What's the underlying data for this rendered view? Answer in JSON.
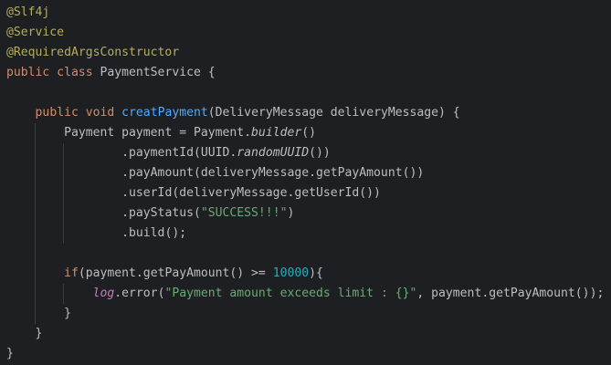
{
  "editor": {
    "colors": {
      "background": "#1e1f22",
      "default_text": "#bcbec4",
      "annotation": "#b3ae60",
      "keyword": "#cf8e6d",
      "method_declaration": "#56a8f5",
      "string": "#6aab73",
      "number": "#2aacb8",
      "static_field": "#c77dbb"
    },
    "lines": {
      "l1": {
        "a": "@Slf4j"
      },
      "l2": {
        "a": "@Service"
      },
      "l3": {
        "a": "@RequiredArgsConstructor"
      },
      "l4": {
        "k": "public class",
        "t": " PaymentService {"
      },
      "l6": {
        "ind": "    ",
        "k": "public void",
        "f": "creatPayment",
        "t": "(DeliveryMessage deliveryMessage) {"
      },
      "l7": {
        "ind": "        ",
        "t1": "Payment payment = Payment.",
        "i": "builder",
        "t2": "()"
      },
      "l8": {
        "ind": "                ",
        "t1": ".paymentId(UUID.",
        "i": "randomUUID",
        "t2": "())"
      },
      "l9": {
        "ind": "                ",
        "t": ".payAmount(deliveryMessage.getPayAmount())"
      },
      "l10": {
        "ind": "                ",
        "t": ".userId(deliveryMessage.getUserId())"
      },
      "l11": {
        "ind": "                ",
        "t1": ".payStatus(",
        "s": "\"SUCCESS!!!\"",
        "t2": ")"
      },
      "l12": {
        "ind": "                ",
        "t": ".build();"
      },
      "l14": {
        "ind": "        ",
        "k": "if",
        "t1": "(payment.getPayAmount() >= ",
        "n": "10000",
        "t2": "){"
      },
      "l15": {
        "ind": "            ",
        "fld": "log",
        "t1": ".error(",
        "s": "\"Payment amount exceeds limit : {}\"",
        "t2": ", payment.getPayAmount());"
      },
      "l16": {
        "ind": "        ",
        "t": "}"
      },
      "l17": {
        "ind": "    ",
        "t": "}"
      },
      "l18": {
        "t": "}"
      }
    }
  }
}
